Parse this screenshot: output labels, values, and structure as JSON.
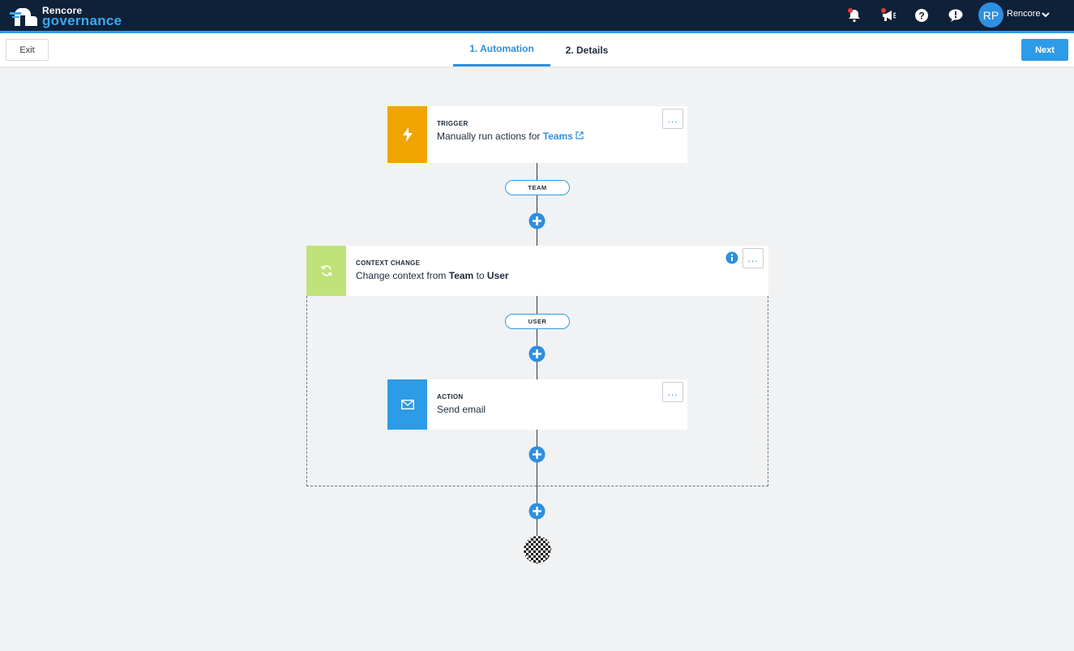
{
  "header": {
    "logo_line1": "Rencore",
    "logo_line2": "governance",
    "user_initials": "RP",
    "user_name": "Rencore",
    "icons": [
      "bell-icon",
      "megaphone-icon",
      "help-icon",
      "feedback-icon"
    ]
  },
  "subheader": {
    "exit_label": "Exit",
    "tabs": [
      {
        "label": "1. Automation",
        "active": true
      },
      {
        "label": "2. Details",
        "active": false
      }
    ],
    "next_label": "Next"
  },
  "flow": {
    "trigger": {
      "label": "TRIGGER",
      "text_prefix": "Manually run actions for",
      "link_text": "Teams",
      "more": "...",
      "color": "#f0a400"
    },
    "pill_team": "TEAM",
    "context_change": {
      "label": "CONTEXT CHANGE",
      "text_prefix": "Change context from",
      "from": "Team",
      "to_word": "to",
      "to": "User",
      "more": "...",
      "color": "#bfe27a"
    },
    "pill_user": "USER",
    "action": {
      "label": "ACTION",
      "text": "Send email",
      "more": "...",
      "color": "#2e9be6"
    }
  },
  "colors": {
    "topbar": "#0f2139",
    "accent": "#2e9be6",
    "background": "#f1f2f3"
  }
}
